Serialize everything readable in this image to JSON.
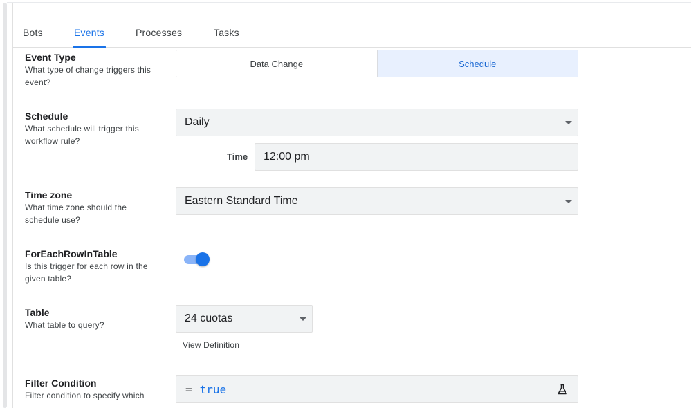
{
  "tabs": [
    {
      "label": "Bots",
      "active": false
    },
    {
      "label": "Events",
      "active": true
    },
    {
      "label": "Processes",
      "active": false
    },
    {
      "label": "Tasks",
      "active": false
    }
  ],
  "event_type": {
    "title": "Event Type",
    "description": "What type of change triggers this event?",
    "options": [
      "Data Change",
      "Schedule"
    ],
    "selected": "Schedule"
  },
  "schedule": {
    "title": "Schedule",
    "description": "What schedule will trigger this workflow rule?",
    "value": "Daily",
    "time_label": "Time",
    "time_value": "12:00 pm"
  },
  "timezone": {
    "title": "Time zone",
    "description": "What time zone should the schedule use?",
    "value": "Eastern Standard Time"
  },
  "for_each_row": {
    "title": "ForEachRowInTable",
    "description": "Is this trigger for each row in the given table?",
    "enabled": true
  },
  "table": {
    "title": "Table",
    "description": "What table to query?",
    "value": "24 cuotas",
    "link": "View Definition"
  },
  "filter": {
    "title": "Filter Condition",
    "description": "Filter condition to specify which",
    "operator": "=",
    "expression": "true"
  },
  "colors": {
    "accent": "#1a73e8",
    "selected_bg": "#e8f0fe",
    "field_bg": "#f1f3f4"
  }
}
